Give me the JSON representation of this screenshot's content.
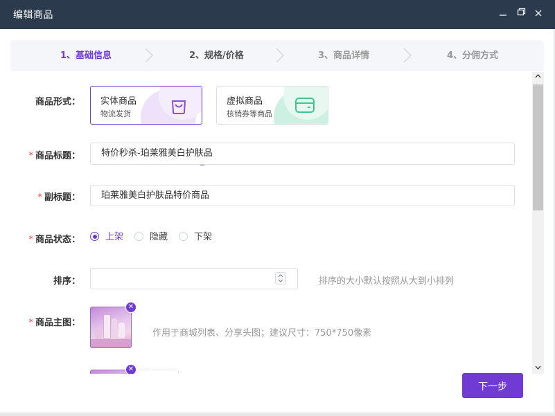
{
  "window": {
    "title": "编辑商品",
    "minimize_icon": "minimize-icon",
    "maximize_icon": "restore-icon",
    "close_icon": "close-icon"
  },
  "steps": [
    {
      "label": "1、基础信息",
      "state": "active"
    },
    {
      "label": "2、规格/价格",
      "state": "done"
    },
    {
      "label": "3、商品详情",
      "state": "pending"
    },
    {
      "label": "4、分佣方式",
      "state": "pending"
    }
  ],
  "form": {
    "product_type": {
      "label": "商品形式：",
      "options": [
        {
          "title": "实体商品",
          "subtitle": "物流发货",
          "icon": "shopping-bag-icon",
          "selected": true
        },
        {
          "title": "虚拟商品",
          "subtitle": "核销券等商品",
          "icon": "card-icon",
          "selected": false
        }
      ]
    },
    "title": {
      "label": "商品标题：",
      "required": "*",
      "value": "特价秒杀-珀莱雅美白护肤品"
    },
    "subtitle": {
      "label": "副标题：",
      "required": "*",
      "value": "珀莱雅美白护肤品特价商品"
    },
    "status": {
      "label": "商品状态：",
      "required": "*",
      "options": [
        "上架",
        "隐藏",
        "下架"
      ],
      "selected": "上架"
    },
    "sort": {
      "label": "排序：",
      "value": "",
      "hint": "排序的大小默认按照从大到小排列"
    },
    "main_image": {
      "label": "商品主图：",
      "required": "*",
      "hint": "作用于商城列表、分享头图；建议尺寸：750*750像素"
    }
  },
  "footer": {
    "next_label": "下一步"
  },
  "colors": {
    "accent": "#6f3bd3",
    "titlebar": "#2b3a4c",
    "required": "#e64b4b",
    "green": "#3fc58e"
  }
}
